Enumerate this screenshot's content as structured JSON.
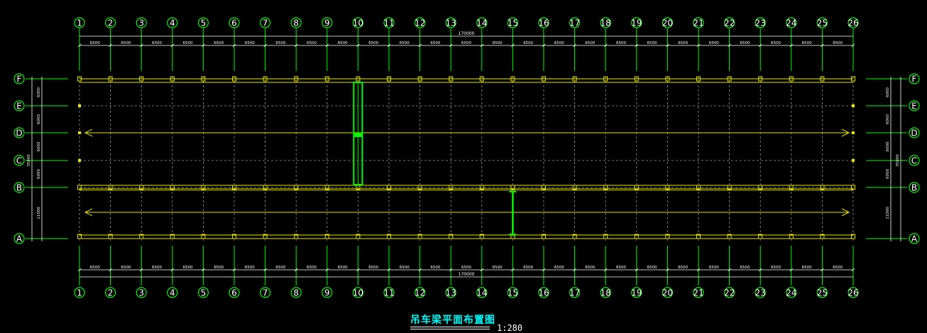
{
  "drawing": {
    "title": "吊车梁平面布置图",
    "scale": "1:280",
    "column_lines": [
      "1",
      "2",
      "3",
      "4",
      "5",
      "6",
      "7",
      "8",
      "9",
      "10",
      "11",
      "12",
      "13",
      "14",
      "15",
      "16",
      "17",
      "18",
      "19",
      "20",
      "21",
      "22",
      "23",
      "24",
      "25",
      "26"
    ],
    "row_lines": [
      "F",
      "E",
      "D",
      "C",
      "B",
      "A"
    ],
    "bay_spacings_top": [
      "6500",
      "6500",
      "6500",
      "6500",
      "6500",
      "6500",
      "6500",
      "6500",
      "6500",
      "6500",
      "6500",
      "6500",
      "6500",
      "6500",
      "6500",
      "6500",
      "6500",
      "6500",
      "6500",
      "6500",
      "6500",
      "6500",
      "6500",
      "6500",
      "6500"
    ],
    "bay_spacings_bottom": [
      "6500",
      "6500",
      "6500",
      "6500",
      "6500",
      "6500",
      "6500",
      "6500",
      "6500",
      "6500",
      "6500",
      "6500",
      "6500",
      "6500",
      "6500",
      "6500",
      "6500",
      "6500",
      "6500",
      "6500",
      "6500",
      "6500",
      "6500",
      "6500",
      "6500"
    ],
    "total_length": "170000",
    "span_segments_left": [
      "6000",
      "6000",
      "6000",
      "6000",
      "11000"
    ],
    "span_segments_right": [
      "6000",
      "6000",
      "6000",
      "6000",
      "11000"
    ],
    "total_span": "35000"
  },
  "colors": {
    "background": "#000000",
    "axis_green": "#00ff00",
    "grid_gray": "#9a9a9a",
    "beam_yellow": "#e8e800",
    "crane_green": "#00ff00",
    "title_cyan": "#00ffff"
  }
}
